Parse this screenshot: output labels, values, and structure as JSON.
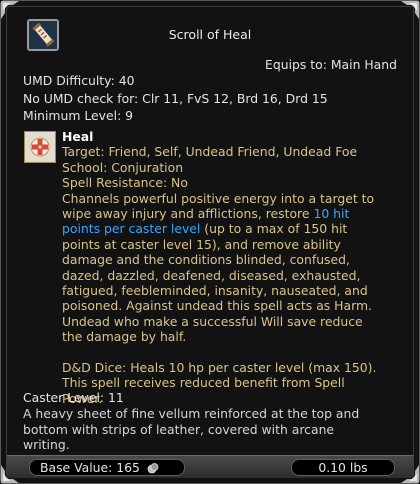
{
  "item": {
    "name": "Scroll of Heal",
    "equips_to": "Equips to: Main Hand",
    "umd_difficulty": "UMD Difficulty: 40",
    "no_umd_check": "No UMD check for: Clr 11, FvS 12, Brd 16, Drd 15",
    "minimum_level": "Minimum Level: 9",
    "icon": "scroll-icon"
  },
  "spell": {
    "name": "Heal",
    "icon": "heal-spell-icon",
    "target": "Target: Friend, Self, Undead Friend, Undead Foe",
    "school": "School: Conjuration",
    "spell_resistance": "Spell Resistance: No",
    "desc_line_1": "Channels powerful positive energy into a target to",
    "desc_line_2": "wipe away injury and afflictions, restore",
    "desc_highlight_1": "10 hit",
    "desc_highlight_2": "points per caster level",
    "desc_line_3_rest": " (up to a max of 150 hit",
    "desc_line_4": "points at caster level 15), and remove ability",
    "desc_line_5": "damage and the conditions blinded, confused,",
    "desc_line_6": "dazed, dazzled, deafened, diseased, exhausted,",
    "desc_line_7": "fatigued, feebleminded, insanity, nauseated, and",
    "desc_line_8": "poisoned. Against undead this spell acts as Harm.",
    "desc_line_9": "Undead who make a successful Will save reduce",
    "desc_line_10": "the damage by half.",
    "dice_line_1": "D&D Dice: Heals 10 hp per caster level (max 150).",
    "dice_line_2": "This spell receives reduced benefit from Spell",
    "dice_line_3": "Power."
  },
  "caster_level": "Caster Level: 11",
  "description": {
    "line_1": "A heavy sheet of fine vellum reinforced at the top and",
    "line_2": "bottom with strips of leather, covered with arcane",
    "line_3": "writing."
  },
  "footer": {
    "base_value_label": "Base Value: 165",
    "weight": "0.10 lbs",
    "coin_icon": "coin-icon"
  },
  "colors": {
    "tan_text": "#d8c48a",
    "highlight_blue": "#37a6ff",
    "background": "#121212"
  }
}
